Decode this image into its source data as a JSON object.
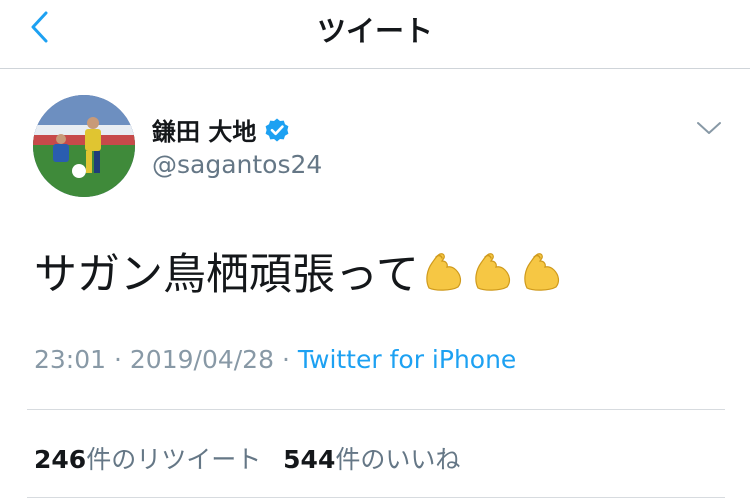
{
  "header": {
    "title": "ツイート"
  },
  "user": {
    "name": "鎌田 大地",
    "handle": "@sagantos24",
    "verified": true
  },
  "tweet": {
    "text": "サガン鳥栖頑張って",
    "emoji_name": "flexed-biceps",
    "emoji_count": 3,
    "time": "23:01",
    "date": "2019/04/28",
    "separator": "·",
    "source": "Twitter for iPhone"
  },
  "stats": {
    "retweets_count": "246",
    "retweets_label": "件のリツイート",
    "likes_count": "544",
    "likes_label": "件のいいね"
  },
  "colors": {
    "link": "#1da1f2",
    "verified": "#1da1f2",
    "secondary_text": "#657786"
  }
}
